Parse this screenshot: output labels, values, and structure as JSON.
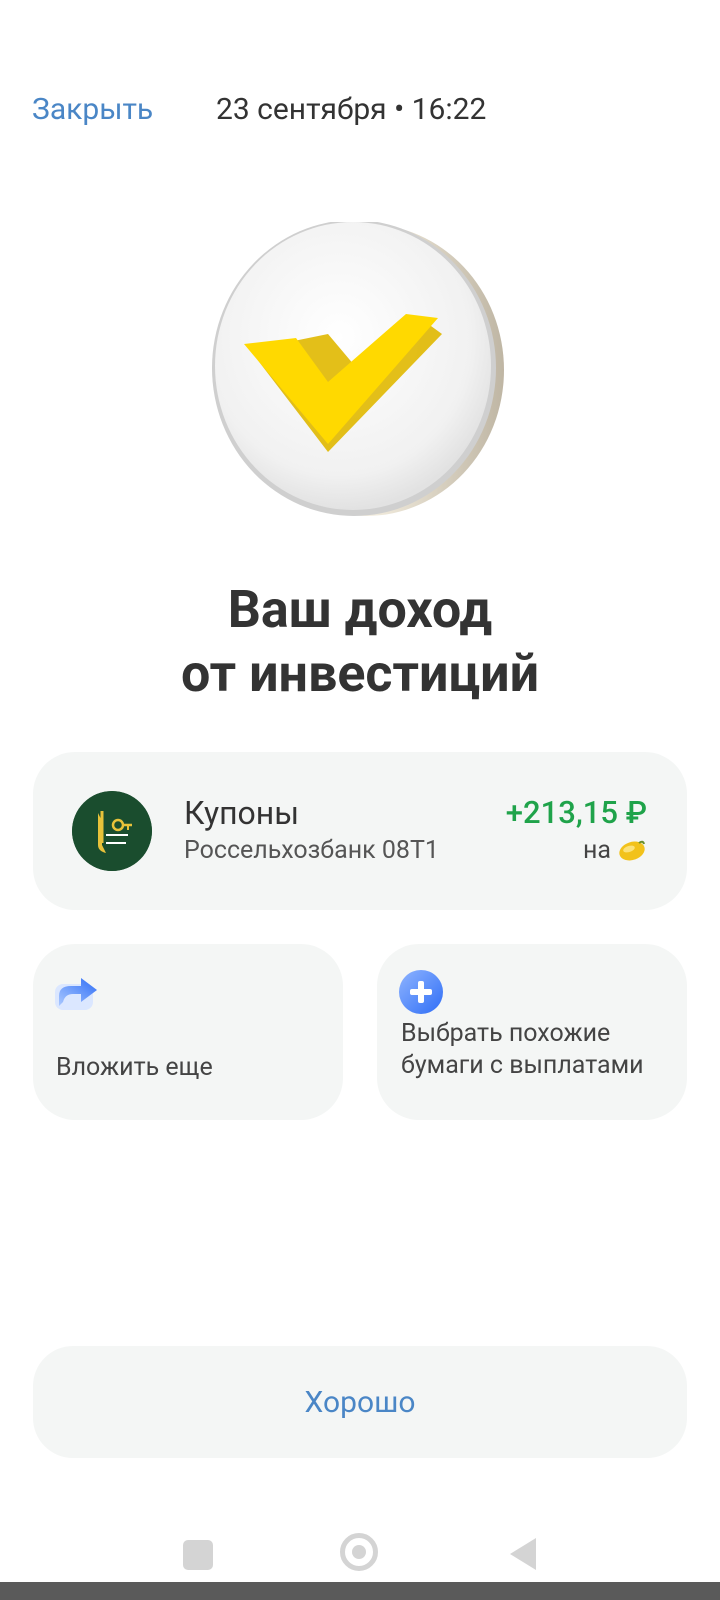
{
  "header": {
    "close_label": "Закрыть",
    "datetime": "23 сентября • 16:22"
  },
  "hero": {
    "icon": "checkmark-coin-icon",
    "check_color": "#ffd400"
  },
  "title": {
    "line1": "Ваш доход",
    "line2": "от инвестиций"
  },
  "income": {
    "label": "Купоны",
    "security": "Россельхозбанк 08Т1",
    "amount": "+213,15 ₽",
    "note": "на",
    "note_icon": "lemon-icon",
    "bank_icon": "rshb-logo-icon",
    "amount_color": "#1fa34a"
  },
  "actions": [
    {
      "label": "Вложить еще",
      "icon": "share-arrow-icon"
    },
    {
      "label": "Выбрать похожие бумаги с выплатами",
      "icon": "plus-circle-icon"
    }
  ],
  "ok_button": {
    "label": "Хорошо"
  },
  "colors": {
    "accent": "#4a86c6",
    "card_bg": "#f4f6f5"
  }
}
